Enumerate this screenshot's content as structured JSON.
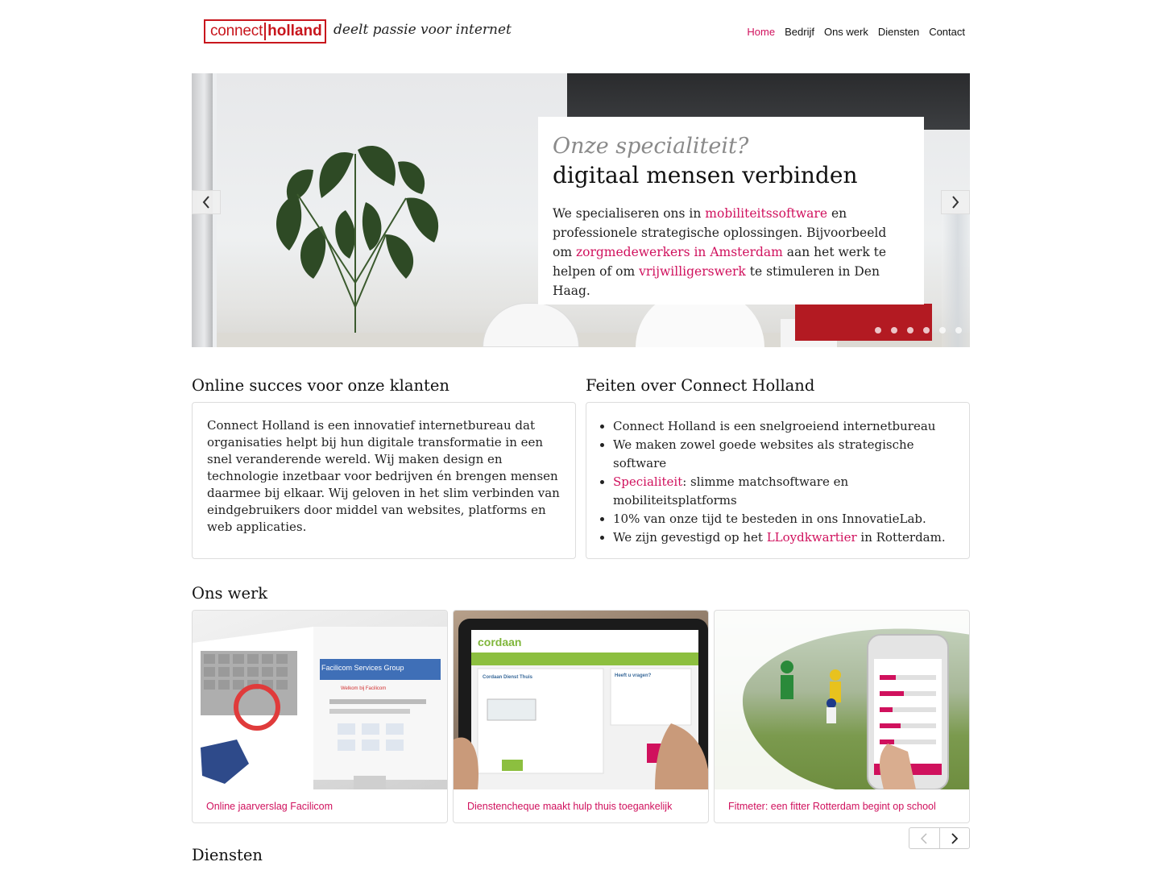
{
  "header": {
    "logo_part1": "connect",
    "logo_part2": "holland",
    "tagline": "deelt passie voor internet",
    "nav": [
      "Home",
      "Bedrijf",
      "Ons werk",
      "Diensten",
      "Contact"
    ],
    "active_nav": "Home"
  },
  "hero": {
    "question": "Onze specialiteit?",
    "headline": "digitaal mensen verbinden",
    "text_1": "We specialiseren ons in ",
    "link_1": "mobiliteitssoftware",
    "text_2": " en professionele strategische oplossingen. Bijvoorbeeld om ",
    "link_2": "zorgmedewerkers in Amsterdam",
    "text_3": " aan het werk te helpen of om ",
    "link_3": "vrijwilligerswerk",
    "text_4": " te stimuleren in Den Haag.",
    "prev_icon": "chevron-left-icon",
    "next_icon": "chevron-right-icon",
    "slide_count": 6
  },
  "succes": {
    "title": "Online succes voor onze klanten",
    "text": "Connect Holland is een innovatief internetbureau dat organisaties helpt bij hun digitale transformatie in een snel veranderende wereld. Wij maken design en technologie inzetbaar voor bedrijven én brengen mensen daarmee bij elkaar. Wij geloven in het slim verbinden van eindgebruikers door middel van websites, platforms en web applicaties."
  },
  "feiten": {
    "title": "Feiten over Connect Holland",
    "item_1": "Connect Holland is een snelgroeiend internetbureau",
    "item_2": "We maken zowel goede websites als strategische software",
    "item_3_link": "Specialiteit",
    "item_3_text": ": slimme matchsoftware en mobiliteitsplatforms",
    "item_4": "10% van onze tijd te besteden in ons InnovatieLab.",
    "item_5_text": "We zijn gevestigd op het ",
    "item_5_link": "LLoydkwartier",
    "item_5_end": " in Rotterdam."
  },
  "work": {
    "title": "Ons werk",
    "items": [
      {
        "caption": "Online jaarverslag Facilicom",
        "screen_title": "Facilicom Services Group",
        "screen_sub": "Welkom bij Facilicom"
      },
      {
        "caption": "Dienstencheque maakt hulp thuis toegankelijk",
        "screen_title": "cordaan",
        "screen_sub": "Cordaan Dienst Thuis",
        "screen_side": "Heeft u vragen?"
      },
      {
        "caption": "Fitmeter: een fitter Rotterdam begint op school"
      }
    ],
    "pager_prev_icon": "chevron-left-icon",
    "pager_next_icon": "chevron-right-icon"
  },
  "diensten": {
    "title": "Diensten"
  },
  "colors": {
    "accent": "#d0115d",
    "logo_red": "#c8161d",
    "border": "#dddddd"
  }
}
